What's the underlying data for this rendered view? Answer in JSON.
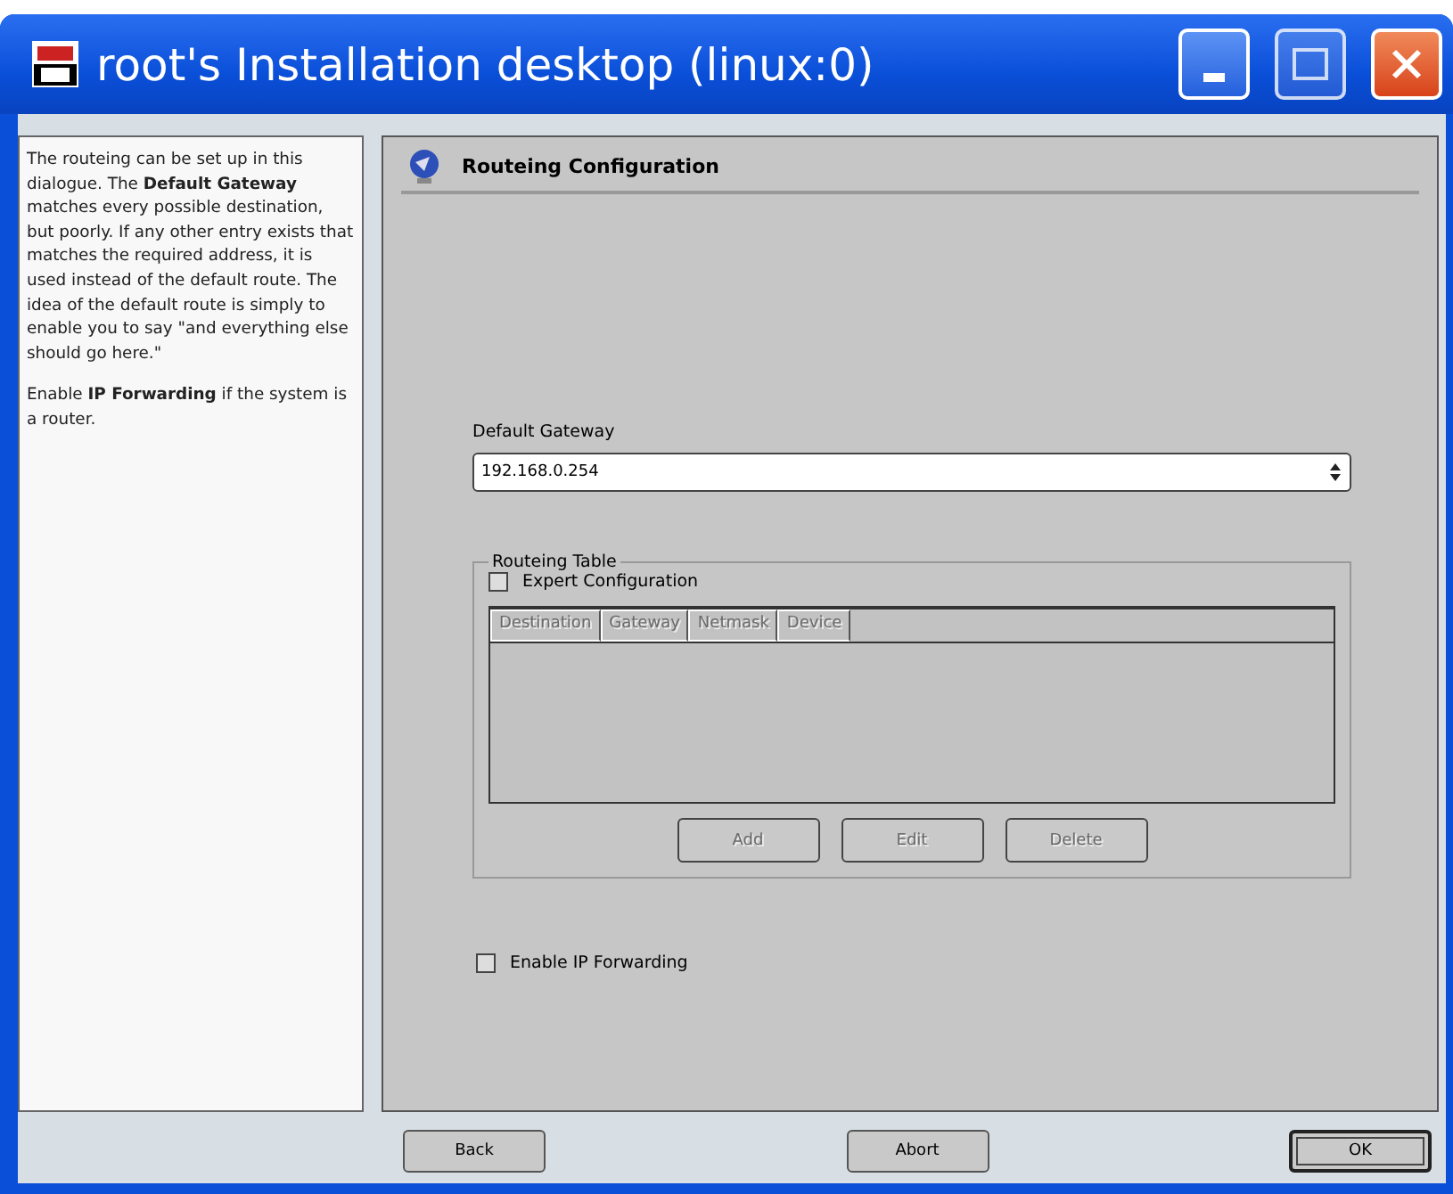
{
  "window": {
    "title": "root's Installation desktop (linux:0)"
  },
  "help": {
    "paragraphs": [
      "The routeing can be set up in this dialogue. The **Default Gateway** matches every possible destination, but poorly. If any other entry exists that matches the required address, it is used instead of the default route. The idea of the default route is simply to enable you to say \"and everything else should go here.\"",
      "Enable **IP Forwarding** if the system is a router."
    ]
  },
  "page": {
    "title": "Routeing Configuration",
    "default_gateway": {
      "label": "Default Gateway",
      "value": "192.168.0.254"
    },
    "routeing_table": {
      "title": "Routeing Table",
      "expert": {
        "label": "Expert Configuration",
        "checked": false
      },
      "columns": [
        {
          "label": "Destination",
          "disabled": true
        },
        {
          "label": "Gateway",
          "disabled": true
        },
        {
          "label": "Netmask",
          "disabled": true
        },
        {
          "label": "Device",
          "disabled": true
        }
      ],
      "buttons": [
        {
          "label": "Add",
          "disabled": true
        },
        {
          "label": "Edit",
          "disabled": true
        },
        {
          "label": "Delete",
          "disabled": true
        }
      ]
    },
    "ip_forwarding": {
      "label": "Enable IP Forwarding",
      "checked": false
    }
  },
  "buttons": [
    {
      "label": "Back",
      "default": false
    },
    {
      "label": "Abort",
      "default": false
    },
    {
      "label": "OK",
      "default": true
    }
  ]
}
